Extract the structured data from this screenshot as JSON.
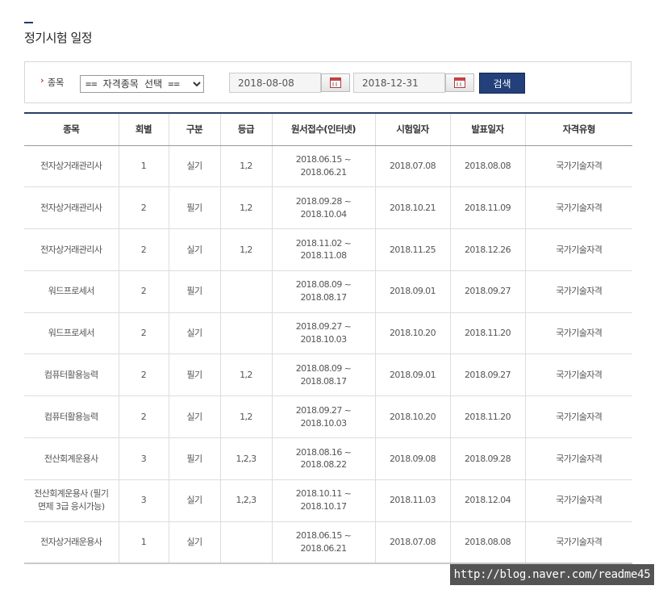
{
  "page": {
    "title": "정기시험 일정"
  },
  "search": {
    "label": "종목",
    "select_value": "== 자격종목 선택 ==",
    "start_date": "2018-08-08",
    "end_date": "2018-12-31",
    "search_button": "검색"
  },
  "table": {
    "headers": [
      "종목",
      "회별",
      "구분",
      "등급",
      "원서접수(인터넷)",
      "시험일자",
      "발표일자",
      "자격유형"
    ],
    "rows": [
      {
        "name": "전자상거래관리사",
        "round": "1",
        "type": "실기",
        "grade": "1,2",
        "apply_start": "2018.06.15 ~",
        "apply_end": "2018.06.21",
        "exam_date": "2018.07.08",
        "result_date": "2018.08.08",
        "cert_type": "국가기술자격"
      },
      {
        "name": "전자상거래관리사",
        "round": "2",
        "type": "필기",
        "grade": "1,2",
        "apply_start": "2018.09.28 ~",
        "apply_end": "2018.10.04",
        "exam_date": "2018.10.21",
        "result_date": "2018.11.09",
        "cert_type": "국가기술자격"
      },
      {
        "name": "전자상거래관리사",
        "round": "2",
        "type": "실기",
        "grade": "1,2",
        "apply_start": "2018.11.02 ~",
        "apply_end": "2018.11.08",
        "exam_date": "2018.11.25",
        "result_date": "2018.12.26",
        "cert_type": "국가기술자격"
      },
      {
        "name": "워드프로세서",
        "round": "2",
        "type": "필기",
        "grade": "",
        "apply_start": "2018.08.09 ~",
        "apply_end": "2018.08.17",
        "exam_date": "2018.09.01",
        "result_date": "2018.09.27",
        "cert_type": "국가기술자격"
      },
      {
        "name": "워드프로세서",
        "round": "2",
        "type": "실기",
        "grade": "",
        "apply_start": "2018.09.27 ~",
        "apply_end": "2018.10.03",
        "exam_date": "2018.10.20",
        "result_date": "2018.11.20",
        "cert_type": "국가기술자격"
      },
      {
        "name": "컴퓨터활용능력",
        "round": "2",
        "type": "필기",
        "grade": "1,2",
        "apply_start": "2018.08.09 ~",
        "apply_end": "2018.08.17",
        "exam_date": "2018.09.01",
        "result_date": "2018.09.27",
        "cert_type": "국가기술자격"
      },
      {
        "name": "컴퓨터활용능력",
        "round": "2",
        "type": "실기",
        "grade": "1,2",
        "apply_start": "2018.09.27 ~",
        "apply_end": "2018.10.03",
        "exam_date": "2018.10.20",
        "result_date": "2018.11.20",
        "cert_type": "국가기술자격"
      },
      {
        "name": "전산회계운용사",
        "round": "3",
        "type": "필기",
        "grade": "1,2,3",
        "apply_start": "2018.08.16 ~",
        "apply_end": "2018.08.22",
        "exam_date": "2018.09.08",
        "result_date": "2018.09.28",
        "cert_type": "국가기술자격"
      },
      {
        "name": "전산회계운용사 (필기면제 3급 응시가능)",
        "round": "3",
        "type": "실기",
        "grade": "1,2,3",
        "apply_start": "2018.10.11 ~",
        "apply_end": "2018.10.17",
        "exam_date": "2018.11.03",
        "result_date": "2018.12.04",
        "cert_type": "국가기술자격"
      },
      {
        "name": "전자상거래운용사",
        "round": "1",
        "type": "실기",
        "grade": "",
        "apply_start": "2018.06.15 ~",
        "apply_end": "2018.06.21",
        "exam_date": "2018.07.08",
        "result_date": "2018.08.08",
        "cert_type": "국가기술자격"
      }
    ]
  },
  "watermark": "http://blog.naver.com/readme45",
  "colors": {
    "accent": "#23407a",
    "table_top_border": "#2b3e66",
    "label_arrow": "#c0392b"
  }
}
